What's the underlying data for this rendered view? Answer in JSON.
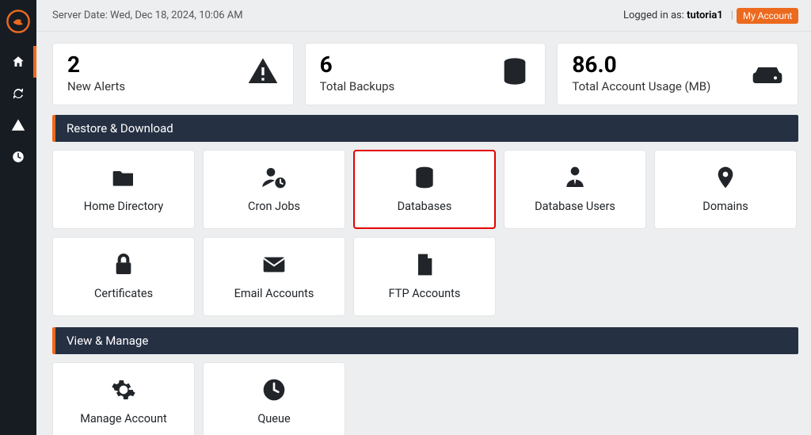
{
  "server_date_label": "Server Date: Wed, Dec 18, 2024, 10:06 AM",
  "logged_in_prefix": "Logged in as: ",
  "username": "tutoria1",
  "my_account_btn": "My Account",
  "stats": {
    "alerts": {
      "value": "2",
      "label": "New Alerts"
    },
    "backups": {
      "value": "6",
      "label": "Total Backups"
    },
    "usage": {
      "value": "86.0",
      "label": "Total Account Usage (MB)"
    }
  },
  "sections": {
    "restore": "Restore & Download",
    "view": "View & Manage"
  },
  "tiles": {
    "home_dir": "Home Directory",
    "cron": "Cron Jobs",
    "databases": "Databases",
    "db_users": "Database Users",
    "domains": "Domains",
    "certs": "Certificates",
    "email": "Email Accounts",
    "ftp": "FTP Accounts",
    "manage_account": "Manage Account",
    "queue": "Queue"
  }
}
